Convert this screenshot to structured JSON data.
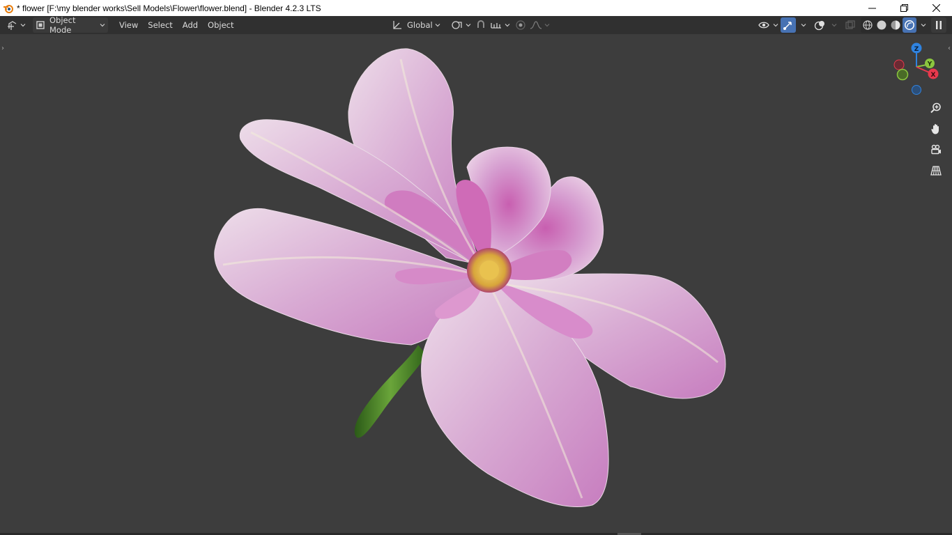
{
  "window": {
    "title": "* flower [F:\\my blender works\\Sell Models\\Flower\\flower.blend] - Blender 4.2.3 LTS",
    "controls": [
      "minimize",
      "restore",
      "close"
    ]
  },
  "header": {
    "editor_type_icon": "editor-type-icon",
    "mode_label": "Object Mode",
    "menus": [
      "View",
      "Select",
      "Add",
      "Object"
    ],
    "transform_orientation": "Global"
  },
  "viewport": {
    "object": "flower",
    "gizmo_axes": [
      "X",
      "Y",
      "Z"
    ],
    "nav_tools": [
      "zoom-icon",
      "pan-hand-icon",
      "camera-view-icon",
      "orthographic-grid-icon"
    ]
  },
  "colors": {
    "title_bg": "#ffffff",
    "header_bg": "#303030",
    "viewport_bg": "#3d3d3d",
    "axis_x": "#e8394d",
    "axis_y": "#8bc63f",
    "axis_z": "#2f83e0",
    "accent": "#4772b3"
  }
}
